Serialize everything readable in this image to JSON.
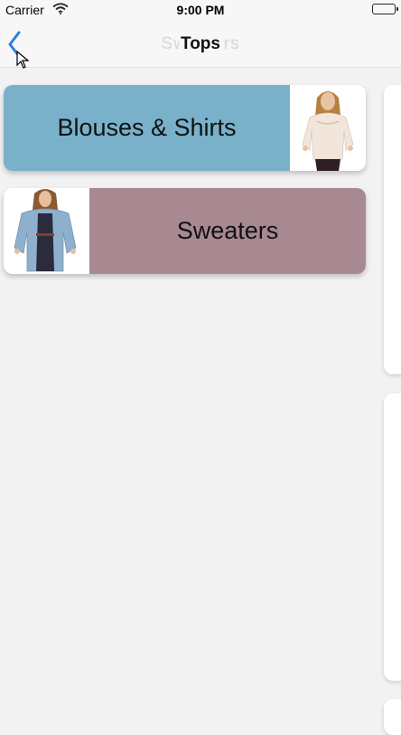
{
  "status_bar": {
    "carrier": "Carrier",
    "time": "9:00 PM",
    "icons": [
      "wifi-icon",
      "battery-icon"
    ]
  },
  "nav": {
    "title": "Tops",
    "faded_previous_title": "Sweaters",
    "back_icon": "chevron-left-icon",
    "accent_color": "#2f7de1"
  },
  "categories": [
    {
      "label": "Blouses & Shirts",
      "color": "#78b1c9",
      "image": "blouse-photo"
    },
    {
      "label": "Sweaters",
      "color": "#a88891",
      "image": "cardigan-photo"
    }
  ]
}
